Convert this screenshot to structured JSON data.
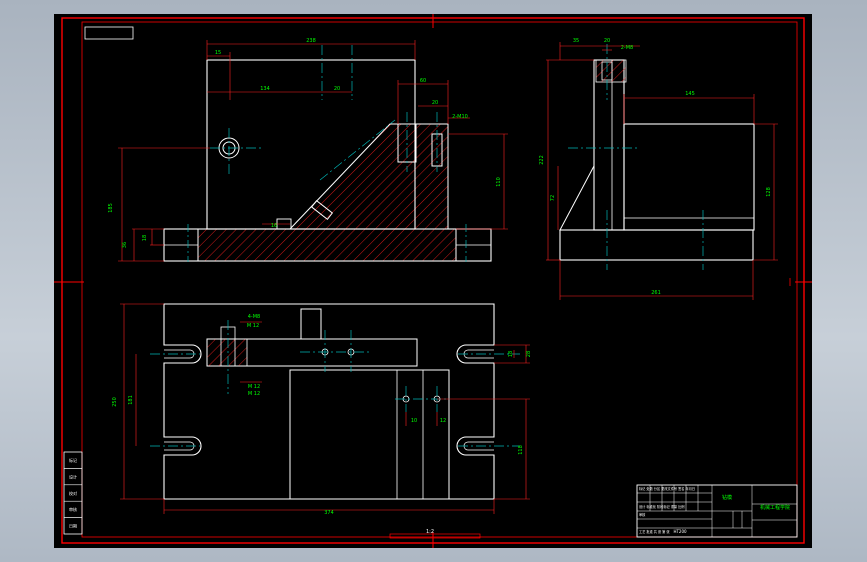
{
  "colors": {
    "background": "#000000",
    "frame": "#ff0000",
    "part": "#ffffff",
    "centerline": "#00b4b4",
    "dimension": "#ff2020",
    "dimension_text": "#00ff00",
    "hatch": "#ff2020"
  },
  "front_view": {
    "dim_width_top": "238",
    "dim_left_offset": "15",
    "dim_hole_x": "134",
    "dim_hole_x2": "20",
    "dim_step": "60",
    "dim_slot": "20",
    "dim_thread": "2-M10",
    "dim_height_total": "185",
    "dim_base": "36",
    "dim_base2": "18",
    "dim_rib": "110",
    "dim_chamfer": "16"
  },
  "side_view": {
    "dim_top_a": "35",
    "dim_top_b": "20",
    "dim_thread": "2-M8",
    "dim_body_w": "145",
    "dim_height": "222",
    "dim_block_h": "128",
    "dim_small": "72",
    "dim_total_w": "261"
  },
  "top_view": {
    "dim_width": "374",
    "dim_depth": "250",
    "dim_slot_span": "181",
    "dim_slot_w": "18",
    "dim_slot_w2": "28",
    "dim_hole_a": "10",
    "dim_hole_b": "12",
    "dim_offset": "118",
    "note_1": "4-M8",
    "note_2": "M 12",
    "note_3": "M 12",
    "note_4": "M 12"
  },
  "bottom_scale": "1:2",
  "side_labels": [
    "标记",
    "设计",
    "校对",
    "审核",
    "日期"
  ],
  "title_block": {
    "drawing_name": "钻模",
    "company": "机械工程学院",
    "material": "HT200",
    "rows": [
      "标记 处数 分区 更改文件号 签名 年月日",
      "设计 标准化 阶段标记 重量 比例",
      "审核",
      "工艺 批准 共 张 第 张"
    ]
  }
}
